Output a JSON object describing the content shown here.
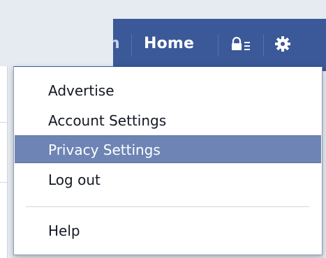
{
  "topbar": {
    "partial_text": "n",
    "home_label": "Home",
    "background_color": "#3b5998",
    "icons": [
      "privacy-shortcuts-icon",
      "gear-icon"
    ]
  },
  "menu": {
    "items": [
      {
        "label": "Advertise"
      },
      {
        "label": "Account Settings"
      },
      {
        "label": "Privacy Settings",
        "active": true
      },
      {
        "label": "Log out"
      }
    ],
    "help_label": "Help",
    "highlight_color": "#6d84b4"
  }
}
